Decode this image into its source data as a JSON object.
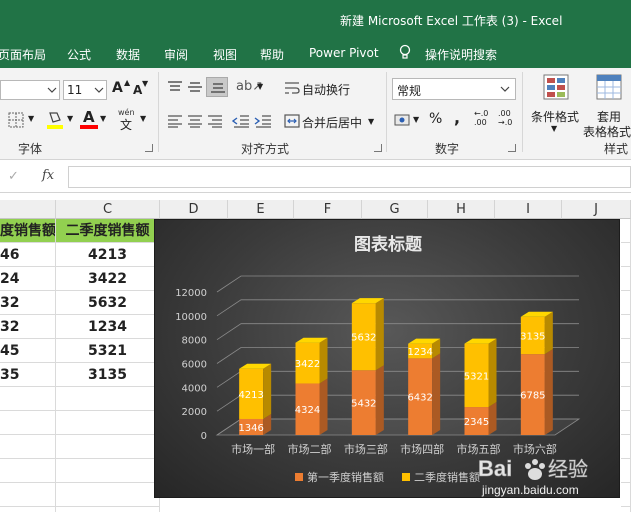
{
  "window": {
    "title": "新建 Microsoft Excel 工作表 (3)  -  Excel"
  },
  "menu": [
    "页面布局",
    "公式",
    "数据",
    "审阅",
    "视图",
    "帮助",
    "Power Pivot",
    "操作说明搜索"
  ],
  "ribbon": {
    "font_size": "11",
    "grow_font": "A",
    "shrink_font": "A",
    "font_color_letter": "A",
    "wrap_text": "自动换行",
    "merge_center": "合并后居中",
    "number_format": "常规",
    "percent": "%",
    "comma": ",",
    "inc_decimal": "←.0\n.00",
    "dec_decimal": ".00\n→.0",
    "cond_format": "条件格式",
    "table_format_top": "套用",
    "table_format_bottom": "表格格式",
    "groups": {
      "font": "字体",
      "alignment": "对齐方式",
      "number": "数字",
      "styles": "样式"
    }
  },
  "formula_bar": {
    "cancel": "✓",
    "fx": "fx",
    "value": ""
  },
  "columns": [
    "C",
    "D",
    "E",
    "F",
    "G",
    "H",
    "I",
    "J"
  ],
  "table": {
    "headers": [
      "度销售额",
      "二季度销售额"
    ],
    "rows": [
      [
        "46",
        "4213"
      ],
      [
        "24",
        "3422"
      ],
      [
        "32",
        "5632"
      ],
      [
        "32",
        "1234"
      ],
      [
        "45",
        "5321"
      ],
      [
        "35",
        "3135"
      ]
    ]
  },
  "chart_data": {
    "type": "bar",
    "stacked": true,
    "title": "图表标题",
    "categories": [
      "市场一部",
      "市场二部",
      "市场三部",
      "市场四部",
      "市场五部",
      "市场六部"
    ],
    "series": [
      {
        "name": "第一季度销售额",
        "values": [
          1346,
          4324,
          5432,
          6432,
          2345,
          6785
        ],
        "color": "#ed7d31"
      },
      {
        "name": "二季度销售额",
        "values": [
          4213,
          3422,
          5632,
          1234,
          5321,
          3135
        ],
        "color": "#ffc000"
      }
    ],
    "ylim": [
      0,
      12000
    ],
    "yticks": [
      "0",
      "2000",
      "4000",
      "6000",
      "8000",
      "10000",
      "12000"
    ],
    "grid": true,
    "legend_position": "bottom"
  },
  "watermark": {
    "brand": "Bai 经验",
    "url": "jingyan.baidu.com"
  },
  "colors": {
    "excel_green": "#217346",
    "header_fill": "#92d050"
  }
}
